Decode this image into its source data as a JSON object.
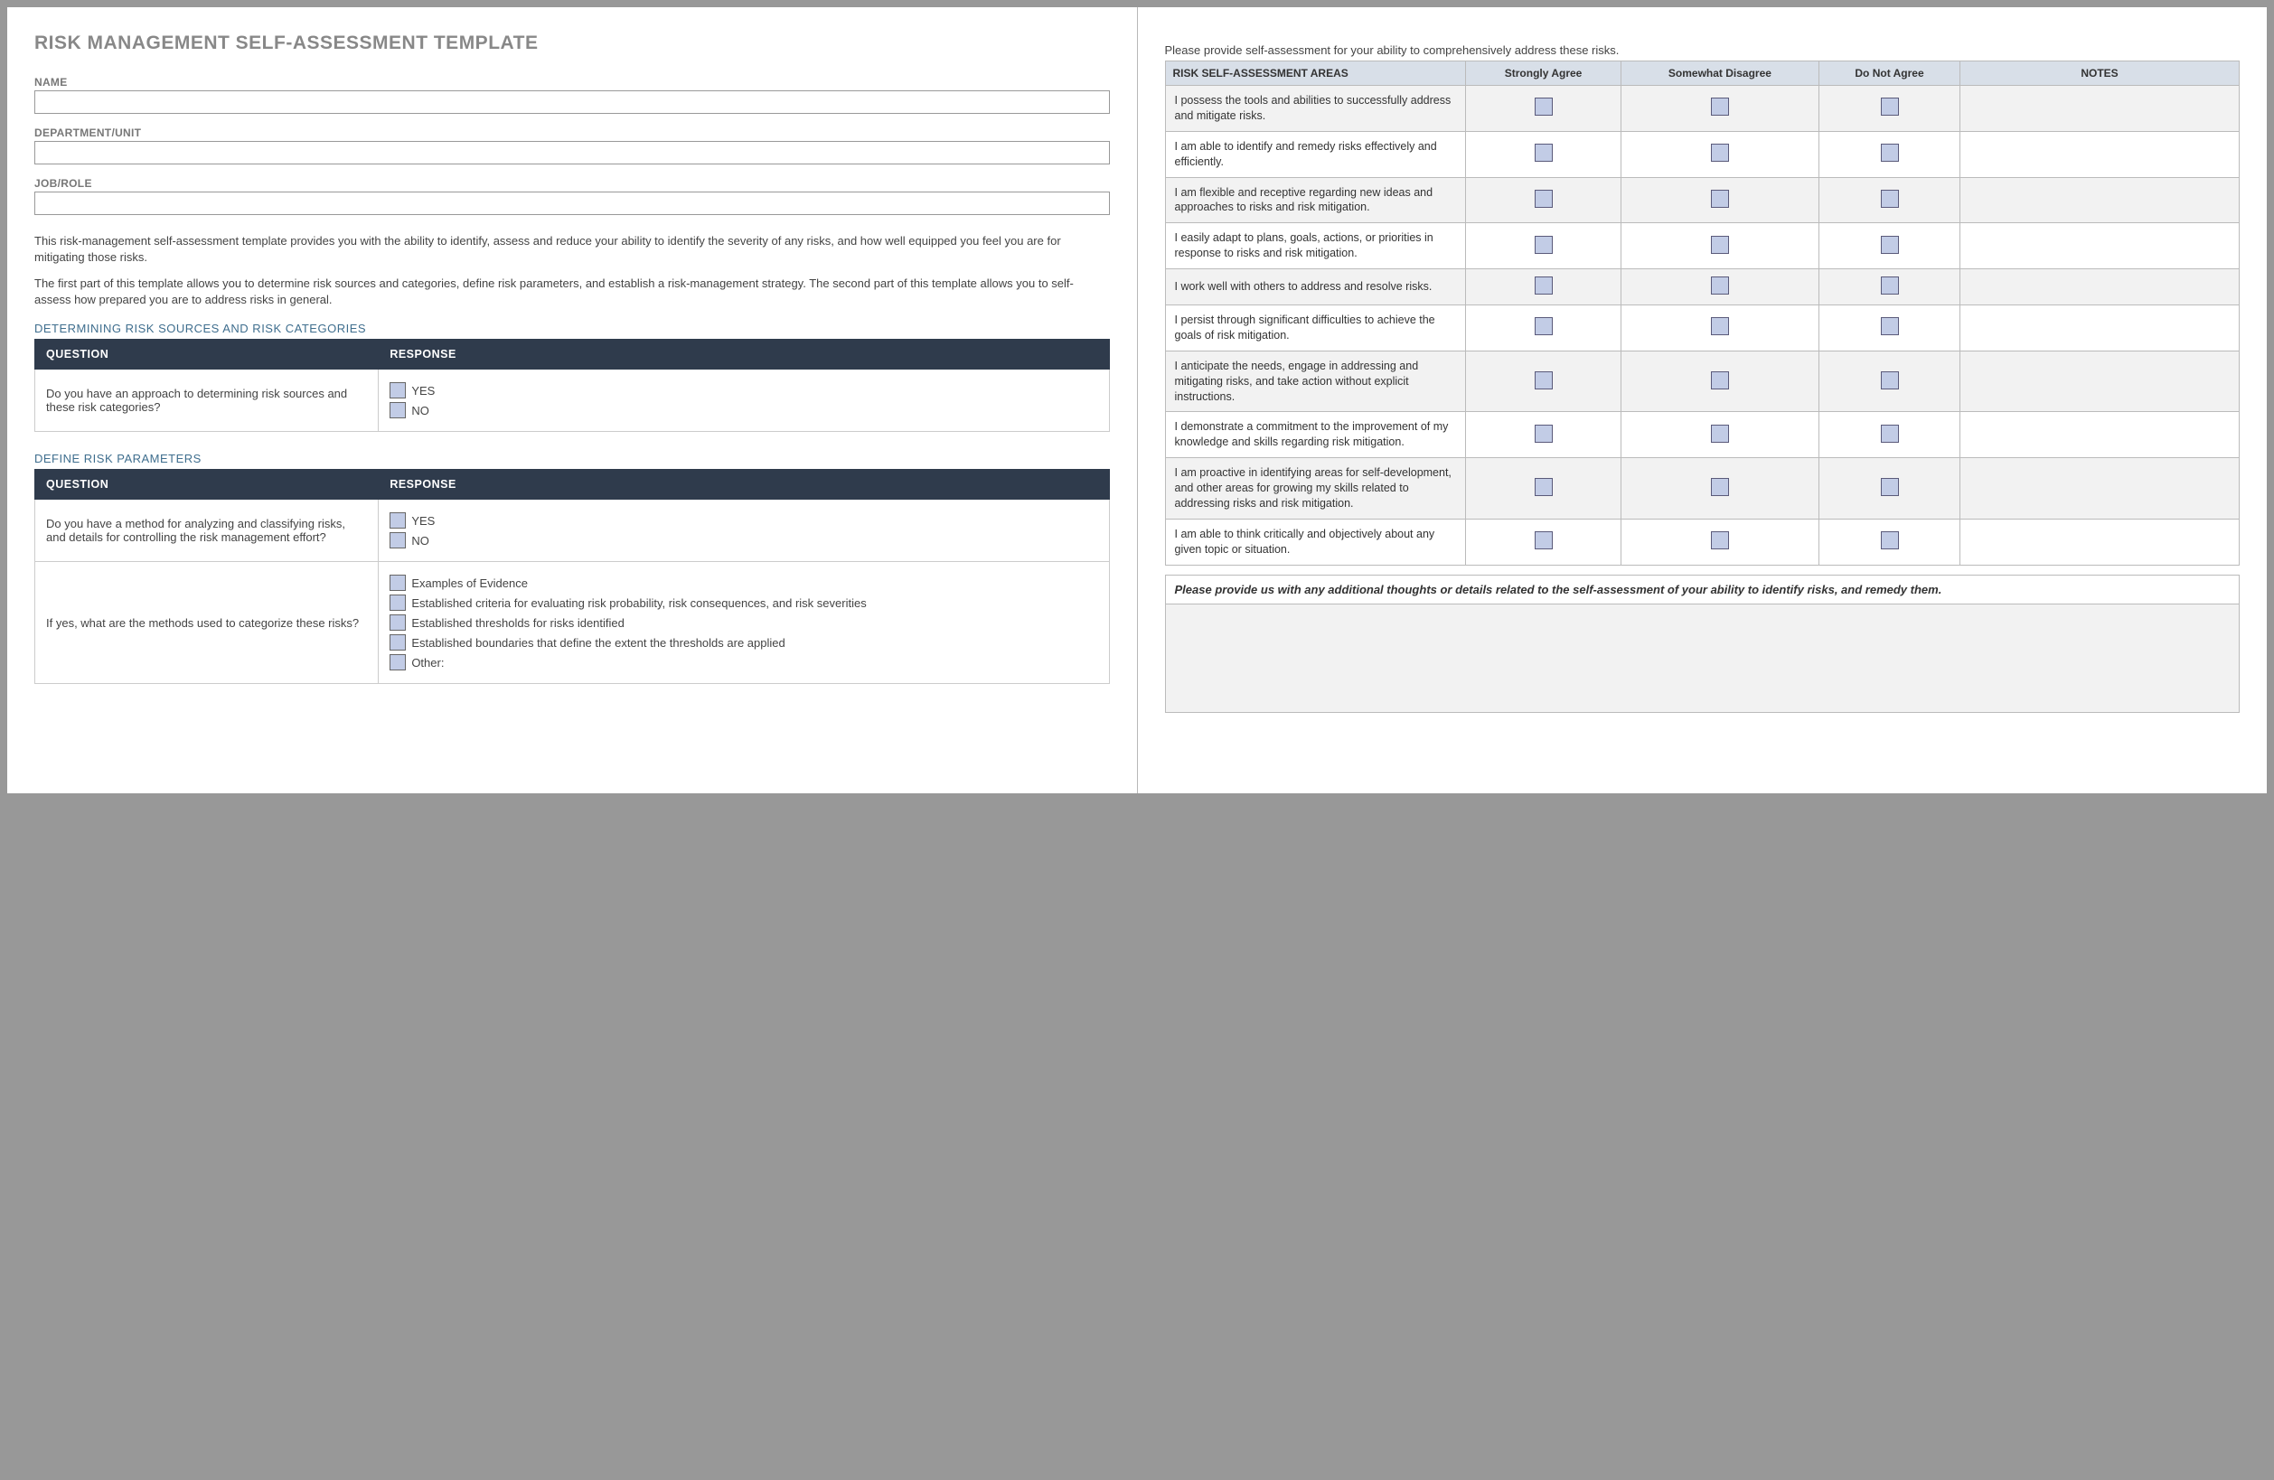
{
  "title": "RISK MANAGEMENT SELF-ASSESSMENT TEMPLATE",
  "fields": {
    "name_label": "NAME",
    "dept_label": "DEPARTMENT/UNIT",
    "role_label": "JOB/ROLE"
  },
  "intro": {
    "p1": "This risk-management self-assessment template provides you with the ability to identify, assess and reduce your ability to identify the severity of any risks, and how well equipped you feel you are for mitigating those risks.",
    "p2": "The first part of this template allows you to determine risk sources and categories, define risk parameters, and establish a risk-management strategy. The second part of this template allows you to self-assess how prepared you are to address risks in general."
  },
  "section1": {
    "heading": "DETERMINING RISK SOURCES AND RISK CATEGORIES",
    "col_q": "QUESTION",
    "col_r": "RESPONSE",
    "q1": "Do you have an approach to determining risk sources and these risk categories?",
    "yes": "YES",
    "no": "NO"
  },
  "section2": {
    "heading": "DEFINE RISK PARAMETERS",
    "col_q": "QUESTION",
    "col_r": "RESPONSE",
    "q1": "Do you have a method for analyzing and classifying risks, and details for controlling the risk management effort?",
    "yes": "YES",
    "no": "NO",
    "q2": "If yes, what are the methods used to categorize these risks?",
    "opts": [
      "Examples of Evidence",
      "Established criteria for evaluating risk probability, risk consequences, and risk severities",
      "Established thresholds for risks identified",
      "Established boundaries that define the extent the thresholds are applied",
      "Other:"
    ]
  },
  "right": {
    "instruction": "Please provide self-assessment for your ability to comprehensively address these risks.",
    "col_area": "RISK SELF-ASSESSMENT AREAS",
    "col_sa": "Strongly Agree",
    "col_sd": "Somewhat Disagree",
    "col_dna": "Do Not Agree",
    "col_notes": "NOTES",
    "rows": [
      "I possess the tools and abilities to successfully address and mitigate risks.",
      "I am able to identify and remedy risks effectively and efficiently.",
      "I am flexible and receptive regarding new ideas and approaches to risks and risk mitigation.",
      "I easily adapt to plans, goals, actions, or priorities in response to risks and risk mitigation.",
      "I work well with others to address and resolve risks.",
      "I persist through significant difficulties to achieve the goals of risk mitigation.",
      "I anticipate the needs, engage in addressing and mitigating risks, and take action without explicit instructions.",
      "I demonstrate a commitment to the improvement of my knowledge and skills regarding risk mitigation.",
      "I am proactive in identifying areas for self-development, and other areas for growing my skills related to addressing risks and risk mitigation.",
      "I am able to think critically and objectively about any given topic or situation."
    ],
    "feedback_head": "Please provide us with any additional thoughts or details related to the self-assessment of your ability to identify risks, and remedy them."
  }
}
